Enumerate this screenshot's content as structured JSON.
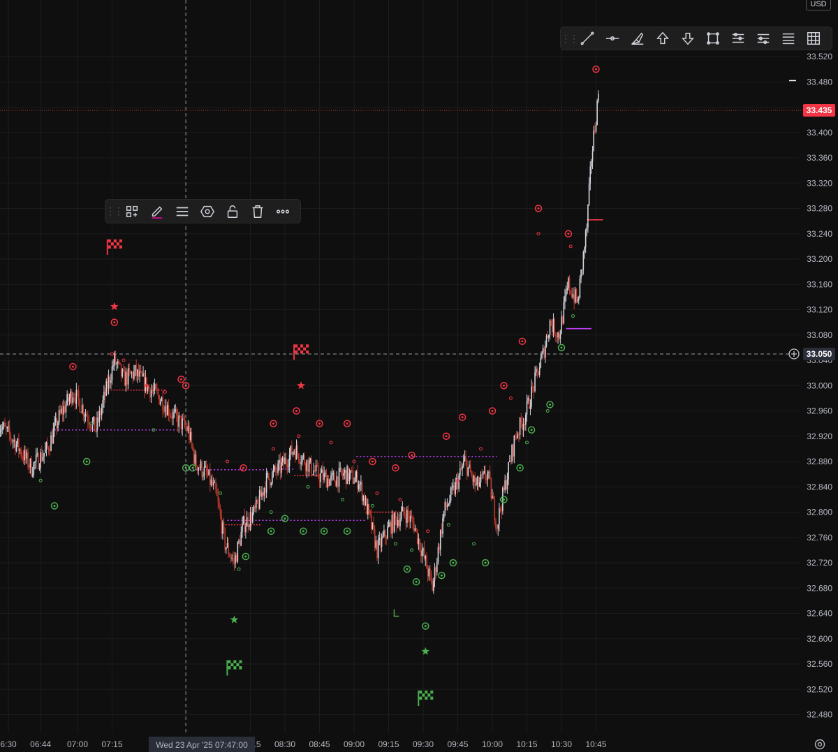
{
  "currency": "USD",
  "chart_data": {
    "type": "candlestick",
    "yticks": [
      "33.520",
      "33.480",
      "33.440",
      "33.400",
      "33.360",
      "33.320",
      "33.280",
      "33.240",
      "33.200",
      "33.160",
      "33.120",
      "33.080",
      "33.040",
      "33.000",
      "32.960",
      "32.920",
      "32.880",
      "32.840",
      "32.800",
      "32.760",
      "32.720",
      "32.680",
      "32.640",
      "32.600",
      "32.560",
      "32.520",
      "32.480"
    ],
    "xticks": [
      "6:30",
      "06:44",
      "07:00",
      "07:15",
      "08:15",
      "08:30",
      "08:45",
      "09:00",
      "09:15",
      "09:30",
      "09:45",
      "10:00",
      "10:15",
      "10:30",
      "10:45"
    ],
    "crosshair_time": "Wed 23 Apr '25   07:47:00",
    "crosshair_price": "33.050",
    "last_price": "33.435",
    "ylim": [
      32.46,
      33.54
    ],
    "path": [
      [
        "06:26",
        32.94
      ],
      [
        "06:33",
        32.91
      ],
      [
        "06:40",
        32.87
      ],
      [
        "06:47",
        32.9
      ],
      [
        "06:52",
        32.95
      ],
      [
        "06:58",
        32.99
      ],
      [
        "07:03",
        32.96
      ],
      [
        "07:08",
        32.93
      ],
      [
        "07:13",
        33.0
      ],
      [
        "07:16",
        33.04
      ],
      [
        "07:20",
        33.01
      ],
      [
        "07:25",
        33.02
      ],
      [
        "07:30",
        33.0
      ],
      [
        "07:36",
        32.98
      ],
      [
        "07:42",
        32.95
      ],
      [
        "07:48",
        32.93
      ],
      [
        "07:51",
        32.88
      ],
      [
        "07:56",
        32.86
      ],
      [
        "08:00",
        32.83
      ],
      [
        "08:04",
        32.75
      ],
      [
        "08:08",
        32.72
      ],
      [
        "08:12",
        32.78
      ],
      [
        "08:17",
        32.8
      ],
      [
        "08:22",
        32.85
      ],
      [
        "08:28",
        32.87
      ],
      [
        "08:34",
        32.9
      ],
      [
        "08:39",
        32.88
      ],
      [
        "08:44",
        32.86
      ],
      [
        "08:50",
        32.85
      ],
      [
        "08:56",
        32.86
      ],
      [
        "09:02",
        32.85
      ],
      [
        "09:06",
        32.8
      ],
      [
        "09:10",
        32.74
      ],
      [
        "09:16",
        32.78
      ],
      [
        "09:22",
        32.8
      ],
      [
        "09:26",
        32.78
      ],
      [
        "09:31",
        32.72
      ],
      [
        "09:34",
        32.68
      ],
      [
        "09:39",
        32.8
      ],
      [
        "09:44",
        32.84
      ],
      [
        "09:48",
        32.88
      ],
      [
        "09:53",
        32.84
      ],
      [
        "09:58",
        32.86
      ],
      [
        "10:02",
        32.78
      ],
      [
        "10:06",
        32.85
      ],
      [
        "10:10",
        32.92
      ],
      [
        "10:14",
        32.95
      ],
      [
        "10:18",
        33.0
      ],
      [
        "10:22",
        33.05
      ],
      [
        "10:25",
        33.1
      ],
      [
        "10:29",
        33.08
      ],
      [
        "10:33",
        33.16
      ],
      [
        "10:37",
        33.13
      ],
      [
        "10:41",
        33.25
      ],
      [
        "10:43",
        33.36
      ],
      [
        "10:46",
        33.46
      ]
    ],
    "signals": {
      "sell_flags": [
        [
          "07:16",
          33.22
        ],
        [
          "08:37",
          33.054
        ]
      ],
      "buy_flags": [
        [
          "08:08",
          32.555
        ],
        [
          "09:31",
          32.507
        ]
      ],
      "sell_stars": [
        [
          "07:16",
          33.125
        ],
        [
          "08:37",
          33.0
        ]
      ],
      "buy_stars": [
        [
          "08:08",
          32.63
        ],
        [
          "09:31",
          32.58
        ]
      ],
      "sell_rings": [
        [
          "06:24",
          33.01
        ],
        [
          "06:58",
          33.03
        ],
        [
          "07:16",
          33.1
        ],
        [
          "07:45",
          33.01
        ],
        [
          "07:47",
          33.0
        ],
        [
          "08:12",
          32.87
        ],
        [
          "08:25",
          32.94
        ],
        [
          "08:35",
          32.96
        ],
        [
          "08:45",
          32.94
        ],
        [
          "08:57",
          32.94
        ],
        [
          "09:08",
          32.88
        ],
        [
          "09:18",
          32.87
        ],
        [
          "09:25",
          32.89
        ],
        [
          "09:40",
          32.92
        ],
        [
          "09:47",
          32.95
        ],
        [
          "10:00",
          32.96
        ],
        [
          "10:05",
          33.0
        ],
        [
          "10:13",
          33.07
        ],
        [
          "10:20",
          33.28
        ],
        [
          "10:33",
          33.24
        ],
        [
          "10:45",
          33.5
        ]
      ],
      "buy_rings": [
        [
          "06:50",
          32.81
        ],
        [
          "07:04",
          32.88
        ],
        [
          "07:47",
          32.87
        ],
        [
          "07:50",
          32.87
        ],
        [
          "08:13",
          32.73
        ],
        [
          "08:24",
          32.77
        ],
        [
          "08:30",
          32.79
        ],
        [
          "08:38",
          32.77
        ],
        [
          "08:47",
          32.77
        ],
        [
          "08:57",
          32.77
        ],
        [
          "09:23",
          32.71
        ],
        [
          "09:27",
          32.69
        ],
        [
          "09:31",
          32.62
        ],
        [
          "09:38",
          32.7
        ],
        [
          "09:43",
          32.72
        ],
        [
          "09:57",
          32.72
        ],
        [
          "10:05",
          32.82
        ],
        [
          "10:12",
          32.87
        ],
        [
          "10:17",
          32.93
        ],
        [
          "10:25",
          32.97
        ],
        [
          "10:30",
          33.06
        ]
      ],
      "small_red": [
        [
          "07:15",
          33.05
        ],
        [
          "07:20",
          33.04
        ],
        [
          "07:30",
          33.0
        ],
        [
          "07:38",
          32.99
        ],
        [
          "08:05",
          32.88
        ],
        [
          "08:25",
          32.9
        ],
        [
          "08:36",
          32.92
        ],
        [
          "08:50",
          32.91
        ],
        [
          "09:00",
          32.88
        ],
        [
          "09:10",
          32.83
        ],
        [
          "09:20",
          32.82
        ],
        [
          "09:32",
          32.77
        ],
        [
          "09:45",
          32.85
        ],
        [
          "09:55",
          32.9
        ],
        [
          "10:08",
          32.98
        ],
        [
          "10:20",
          33.24
        ],
        [
          "10:34",
          33.22
        ]
      ],
      "small_green": [
        [
          "06:44",
          32.85
        ],
        [
          "07:06",
          32.94
        ],
        [
          "07:33",
          32.93
        ],
        [
          "08:02",
          32.83
        ],
        [
          "08:10",
          32.71
        ],
        [
          "08:24",
          32.8
        ],
        [
          "08:40",
          32.84
        ],
        [
          "08:55",
          32.82
        ],
        [
          "09:08",
          32.81
        ],
        [
          "09:18",
          32.75
        ],
        [
          "09:25",
          32.74
        ],
        [
          "09:41",
          32.78
        ],
        [
          "09:52",
          32.75
        ],
        [
          "10:04",
          32.82
        ],
        [
          "10:15",
          32.91
        ],
        [
          "10:24",
          32.96
        ],
        [
          "10:35",
          33.11
        ]
      ],
      "hook": [
        "09:18",
        32.64
      ]
    },
    "levels": {
      "purple_dotted": [
        [
          "06:50",
          "07:44",
          32.93
        ],
        [
          "07:47",
          "08:21",
          32.867
        ],
        [
          "08:24",
          "08:34",
          32.868
        ],
        [
          "09:01",
          "10:02",
          32.888
        ],
        [
          "08:05",
          "09:05",
          32.787
        ]
      ],
      "red_dotted": [
        [
          "07:12",
          "07:38",
          32.993
        ],
        [
          "08:03",
          "08:20",
          32.78
        ],
        [
          "08:34",
          "08:47",
          32.858
        ],
        [
          "09:05",
          "09:20",
          32.8
        ]
      ],
      "red_solid": [
        [
          "10:41",
          "10:48",
          33.262
        ]
      ],
      "purple_solid": [
        [
          "10:32",
          "10:43",
          33.09
        ]
      ],
      "last_price_line": 33.435,
      "crosshair_time": "07:47",
      "crosshair_level": 33.05
    }
  },
  "top_toolbar": {
    "tools": [
      "trend-line-icon",
      "horizontal-ray-icon",
      "brush-icon",
      "arrow-up-icon",
      "arrow-down-icon",
      "rectangle-icon",
      "long-position-icon",
      "short-position-icon",
      "fib-icon",
      "grid-icon"
    ]
  },
  "float_toolbar": {
    "tools": [
      "templates-icon",
      "pencil-color-icon",
      "line-style-icon",
      "settings-hex-icon",
      "unlock-icon",
      "trash-icon",
      "more-icon"
    ]
  },
  "colors": {
    "bg": "#0f0f0f",
    "bull": "#d1d4dc",
    "bear": "#c0392b",
    "sell": "#f23645",
    "buy": "#4caf50",
    "purple": "#c040fb",
    "grid": "#1c1c1c"
  }
}
